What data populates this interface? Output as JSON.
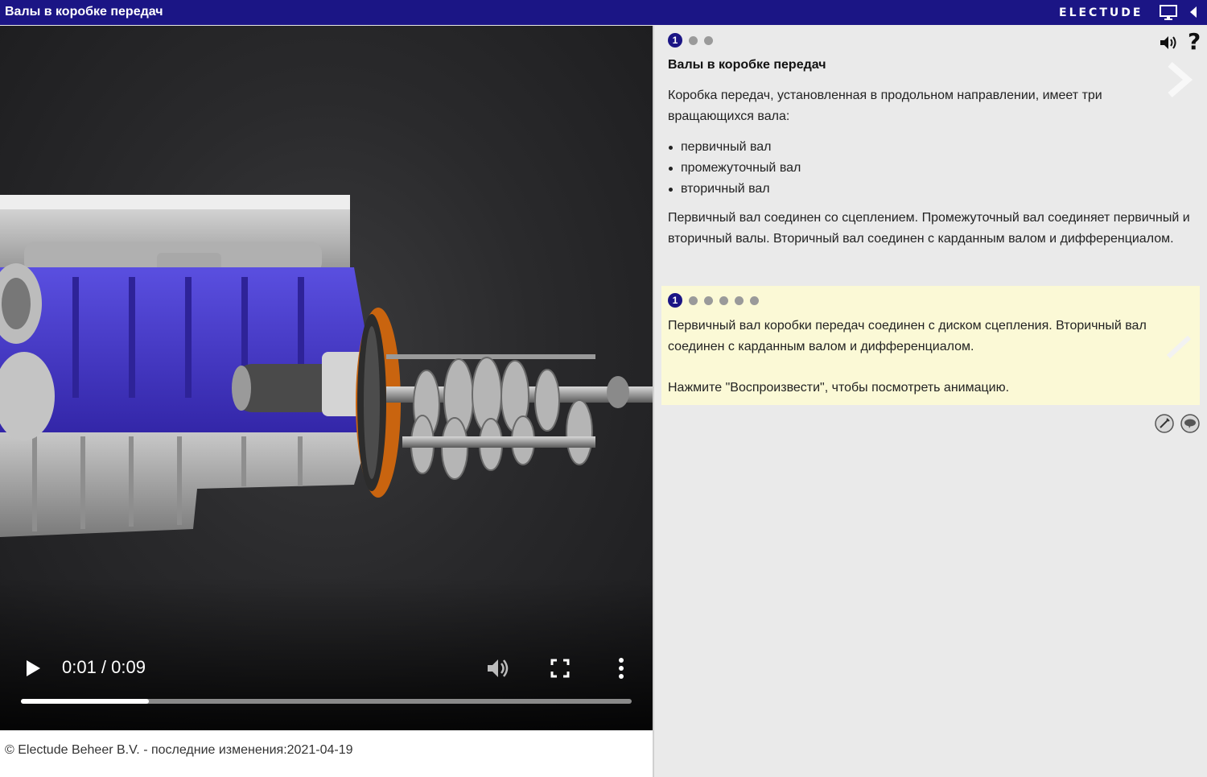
{
  "app": {
    "title": "Валы в коробке передач",
    "brand": "ELECTUDE"
  },
  "video": {
    "time": "0:01 / 0:09",
    "progress": 0.21
  },
  "footer": {
    "copyright": "© Electude Beheer B.V. - последние изменения:2021-04-19"
  },
  "lesson": {
    "page_dots": {
      "active": "1",
      "count": 3
    },
    "heading": "Валы в коробке передач",
    "intro": "Коробка передач, установленная в продольном направлении, имеет три вращающихся вала:",
    "bullets": [
      "первичный вал",
      "промежуточный вал",
      "вторичный вал"
    ],
    "description": "Первичный вал соединен со сцеплением. Промежуточный вал соединяет первичный и вторичный валы. Вторичный вал соединен с карданным валом и дифференциалом."
  },
  "step_box": {
    "step_dots": {
      "active": "1",
      "count": 6
    },
    "text": "Первичный вал коробки передач соединен с диском сцепления. Вторичный вал соединен с карданным валом и дифференциалом.",
    "instruction": "Нажмите \"Воспроизвести\", чтобы посмотреть анимацию."
  },
  "icons": [
    "screen-icon",
    "collapse-arrow-icon",
    "play-icon",
    "volume-icon",
    "fullscreen-icon",
    "more-vertical-icon",
    "sound-icon",
    "help-icon",
    "next-arrow-icon",
    "check-icon",
    "tool-icon",
    "chat-icon"
  ],
  "colors": {
    "topbar": "#1b1585",
    "step_box": "#fbf9d6",
    "engine_block": "#4d3fd0"
  }
}
